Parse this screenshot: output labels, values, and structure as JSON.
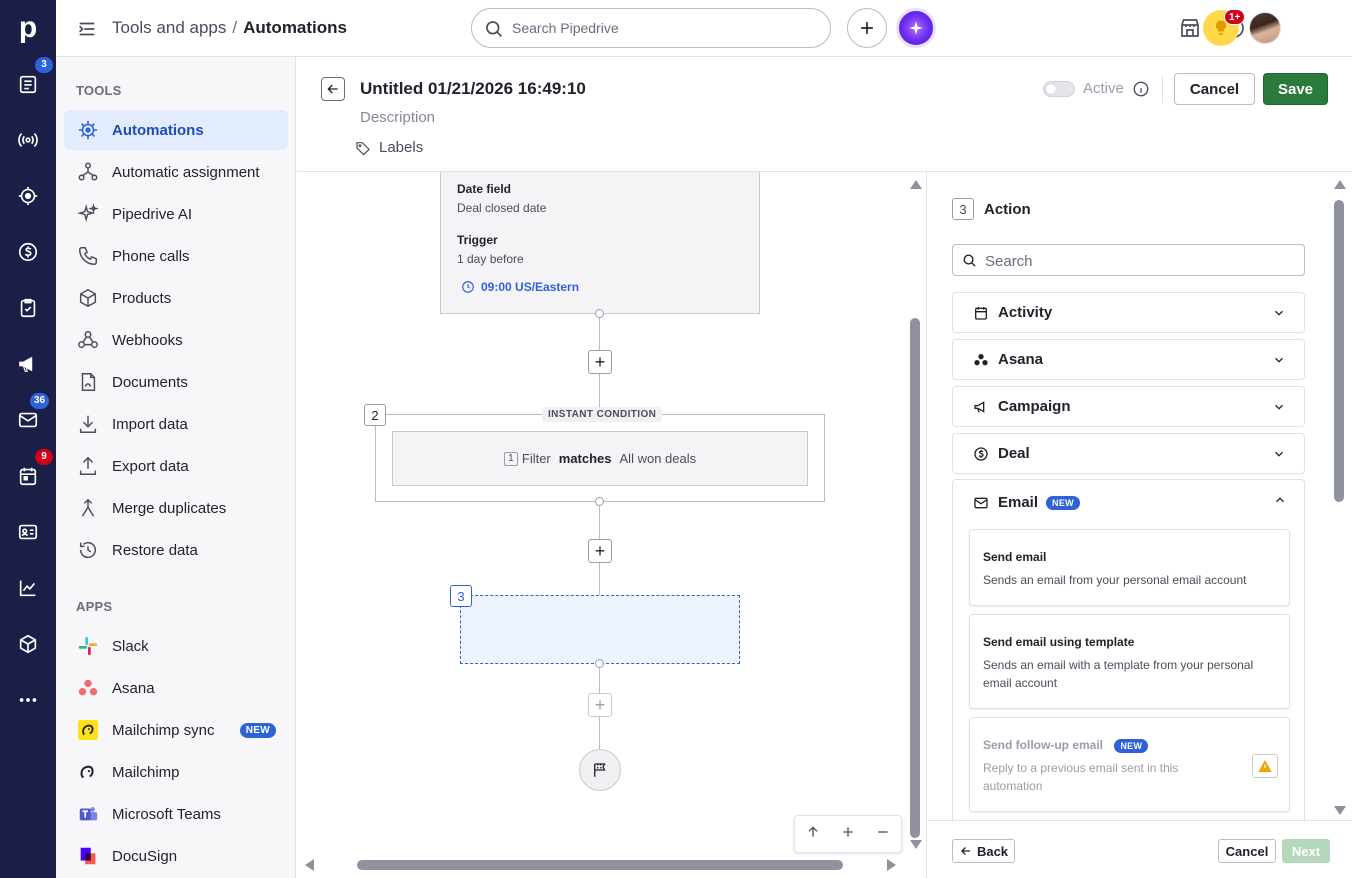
{
  "rail": {
    "logo": "p",
    "badges": {
      "leads": "3",
      "mail": "36",
      "activities": "9"
    }
  },
  "topbar": {
    "breadcrumb_parent": "Tools and apps",
    "breadcrumb_sep": "/",
    "breadcrumb_current": "Automations",
    "search_placeholder": "Search Pipedrive",
    "notif_badge": "1+"
  },
  "sidebar": {
    "tools_heading": "TOOLS",
    "tools": [
      {
        "label": "Automations",
        "icon": "automations-icon",
        "active": true
      },
      {
        "label": "Automatic assignment",
        "icon": "assignment-icon"
      },
      {
        "label": "Pipedrive AI",
        "icon": "sparkle-icon"
      },
      {
        "label": "Phone calls",
        "icon": "phone-icon"
      },
      {
        "label": "Products",
        "icon": "box-icon"
      },
      {
        "label": "Webhooks",
        "icon": "webhook-icon"
      },
      {
        "label": "Documents",
        "icon": "document-icon"
      },
      {
        "label": "Import data",
        "icon": "import-icon"
      },
      {
        "label": "Export data",
        "icon": "export-icon"
      },
      {
        "label": "Merge duplicates",
        "icon": "merge-icon"
      },
      {
        "label": "Restore data",
        "icon": "restore-icon"
      }
    ],
    "apps_heading": "APPS",
    "apps": [
      {
        "label": "Slack",
        "icon": "slack-icon"
      },
      {
        "label": "Asana",
        "icon": "asana-icon"
      },
      {
        "label": "Mailchimp sync",
        "icon": "mailchimp-icon",
        "badge": "NEW"
      },
      {
        "label": "Mailchimp",
        "icon": "mailchimp-icon"
      },
      {
        "label": "Microsoft Teams",
        "icon": "teams-icon"
      },
      {
        "label": "DocuSign",
        "icon": "docusign-icon"
      }
    ]
  },
  "editor": {
    "title": "Untitled 01/21/2026 16:49:10",
    "description_placeholder": "Description",
    "labels": "Labels",
    "active_label": "Active",
    "active": false,
    "cancel": "Cancel",
    "save": "Save"
  },
  "canvas": {
    "trigger_node": {
      "date_field_label": "Date field",
      "date_field_value": "Deal closed date",
      "trigger_label": "Trigger",
      "trigger_value": "1 day before",
      "time": "09:00 US/Eastern"
    },
    "condition_node": {
      "step": "2",
      "tag": "INSTANT CONDITION",
      "filter_num": "1",
      "filter_word": "Filter",
      "matches": "matches",
      "filter_value": "All won deals"
    },
    "action_node": {
      "step": "3"
    }
  },
  "panel": {
    "step": "3",
    "title": "Action",
    "search_placeholder": "Search",
    "groups": [
      {
        "label": "Activity",
        "icon": "calendar-icon"
      },
      {
        "label": "Asana",
        "icon": "asana-icon"
      },
      {
        "label": "Campaign",
        "icon": "megaphone-icon"
      },
      {
        "label": "Deal",
        "icon": "dollar-icon"
      }
    ],
    "email": {
      "label": "Email",
      "badge": "NEW",
      "options": [
        {
          "title": "Send email",
          "desc": "Sends an email from your personal email account"
        },
        {
          "title": "Send email using template",
          "desc": "Sends an email with a template from your personal email account"
        },
        {
          "title": "Send follow-up email",
          "badge": "NEW",
          "desc": "Reply to a previous email sent in this automation",
          "disabled": true
        }
      ]
    },
    "back": "Back",
    "cancel": "Cancel",
    "next": "Next"
  },
  "colors": {
    "rail_bg": "#1b1f48",
    "accent_blue": "#2e62d9",
    "save_green": "#2a7a3b",
    "badge_red": "#d0021b"
  }
}
